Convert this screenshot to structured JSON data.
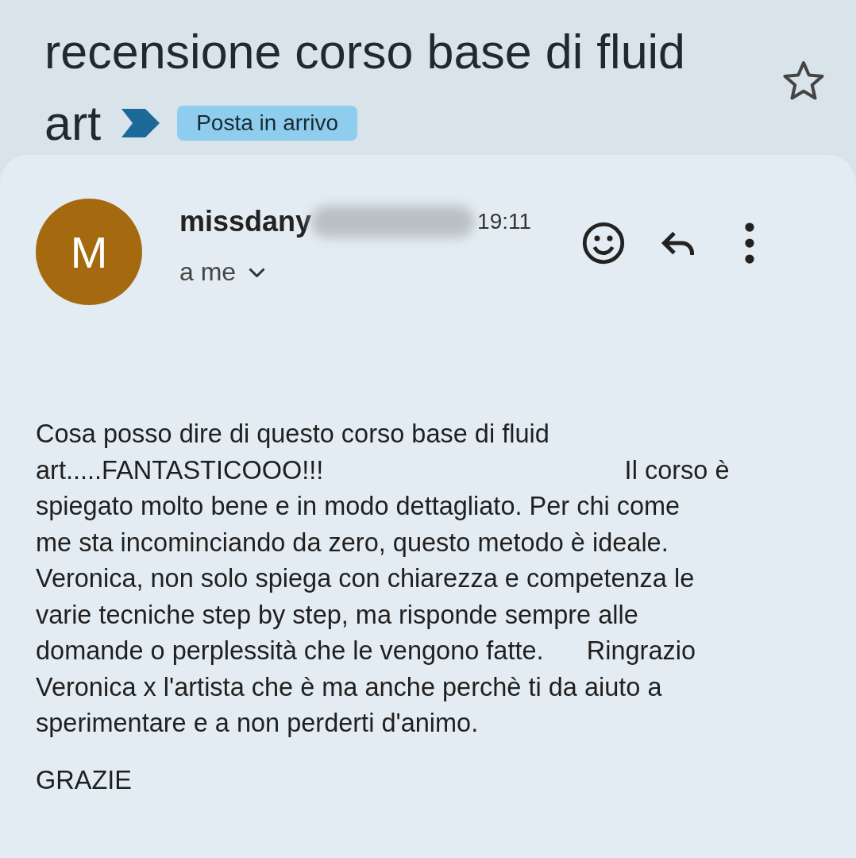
{
  "subject": {
    "title_lines": [
      "recensione corso base di fluid",
      "art"
    ],
    "label": "Posta in arrivo",
    "starred": false
  },
  "message": {
    "avatar": {
      "letter": "M",
      "color": "#a5690f"
    },
    "sender": "missdany",
    "time": "19:11",
    "recipient": "a me",
    "body_lines": [
      "Cosa posso dire di questo corso base di fluid",
      "art.....FANTASTICOOO!!!                                          Il corso è",
      "spiegato molto bene e in modo dettagliato. Per chi come",
      "me sta incominciando da zero, questo metodo è ideale.",
      "Veronica, non solo spiega con chiarezza e competenza le",
      "varie tecniche step by step, ma risponde sempre alle",
      "domande o perplessità che le vengono fatte.      Ringrazio",
      "Veronica x l'artista che è ma anche perchè ti da aiuto a",
      "sperimentare e a non perderti d'animo."
    ],
    "closing": "GRAZIE"
  }
}
